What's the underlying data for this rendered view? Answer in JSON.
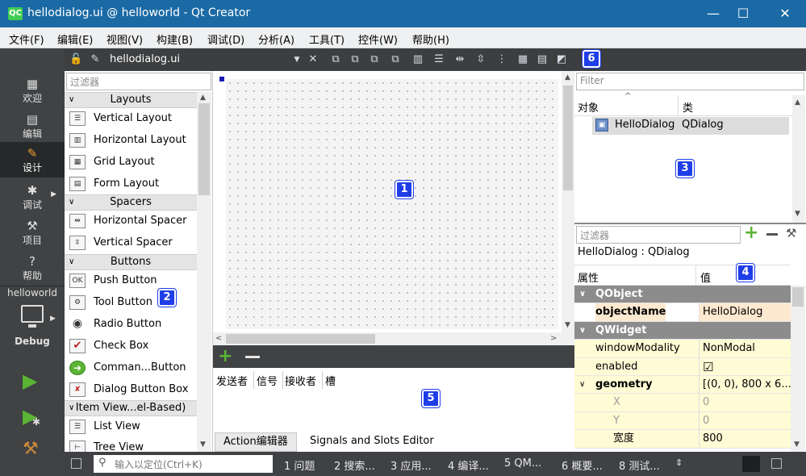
{
  "titlebar": {
    "icon_text": "QC",
    "title": "hellodialog.ui @ helloworld - Qt Creator",
    "minimize": "—",
    "maximize": "☐",
    "close": "✕"
  },
  "menubar": {
    "items": [
      "文件(F)",
      "编辑(E)",
      "视图(V)",
      "构建(B)",
      "调试(D)",
      "分析(A)",
      "工具(T)",
      "控件(W)",
      "帮助(H)"
    ]
  },
  "modes": [
    {
      "label": "欢迎",
      "icon": "grid-icon"
    },
    {
      "label": "编辑",
      "icon": "document-icon"
    },
    {
      "label": "设计",
      "icon": "pencil-icon"
    },
    {
      "label": "调试",
      "icon": "bug-icon"
    },
    {
      "label": "项目",
      "icon": "wrench-icon"
    },
    {
      "label": "帮助",
      "icon": "help-icon"
    }
  ],
  "target": {
    "project": "helloworld",
    "config": "Debug"
  },
  "editor_toolbar": {
    "file_name": "hellodialog.ui"
  },
  "widget_box": {
    "filter_placeholder": "过滤器",
    "categories": {
      "layouts": "Layouts",
      "spacers": "Spacers",
      "buttons": "Buttons",
      "itemviews": "Item View...el-Based)"
    },
    "items": {
      "vertical_layout": "Vertical Layout",
      "horizontal_layout": "Horizontal Layout",
      "grid_layout": "Grid Layout",
      "form_layout": "Form Layout",
      "horizontal_spacer": "Horizontal Spacer",
      "vertical_spacer": "Vertical Spacer",
      "push_button": "Push Button",
      "tool_button": "Tool Button",
      "radio_button": "Radio Button",
      "check_box": "Check Box",
      "command_link_button": "Comman...Button",
      "dialog_button_box": "Dialog Button Box",
      "list_view": "List View",
      "tree_view": "Tree View"
    }
  },
  "object_inspector": {
    "filter_placeholder": "Filter",
    "col_object": "对象",
    "col_class": "类",
    "row_object": "HelloDialog",
    "row_class": "QDialog"
  },
  "property_editor": {
    "filter_placeholder": "过滤器",
    "class_label": "HelloDialog : QDialog",
    "col_property": "属性",
    "col_value": "值",
    "rows": {
      "qobject": "QObject",
      "objectname_name": "objectName",
      "objectname_value": "HelloDialog",
      "qwidget": "QWidget",
      "windowmodality_name": "windowModality",
      "windowmodality_value": "NonModal",
      "enabled_name": "enabled",
      "enabled_value": "☑",
      "geometry_name": "geometry",
      "geometry_value": "[(0, 0), 800 x 6...",
      "x_name": "X",
      "x_value": "0",
      "y_name": "Y",
      "y_value": "0",
      "width_name": "宽度",
      "width_value": "800"
    }
  },
  "signals_slots": {
    "col_sender": "发送者",
    "col_signal": "信号",
    "col_receiver": "接收者",
    "col_slot": "槽",
    "tab_action": "Action编辑器",
    "tab_signals": "Signals and Slots Editor"
  },
  "statusbar": {
    "locator_placeholder": "输入以定位(Ctrl+K)",
    "items": [
      "1 问题",
      "2 搜索...",
      "3 应用...",
      "4 编译...",
      "5 QM...",
      "6 概要...",
      "8 测试..."
    ]
  },
  "badges": [
    "1",
    "2",
    "3",
    "4",
    "5",
    "6"
  ],
  "colors": {
    "titlebar": "#1b6aa5",
    "sidebar": "#404244",
    "badge": "#1f3ee8",
    "group_row": "#8c8c8c",
    "run_green": "#5bb434"
  }
}
